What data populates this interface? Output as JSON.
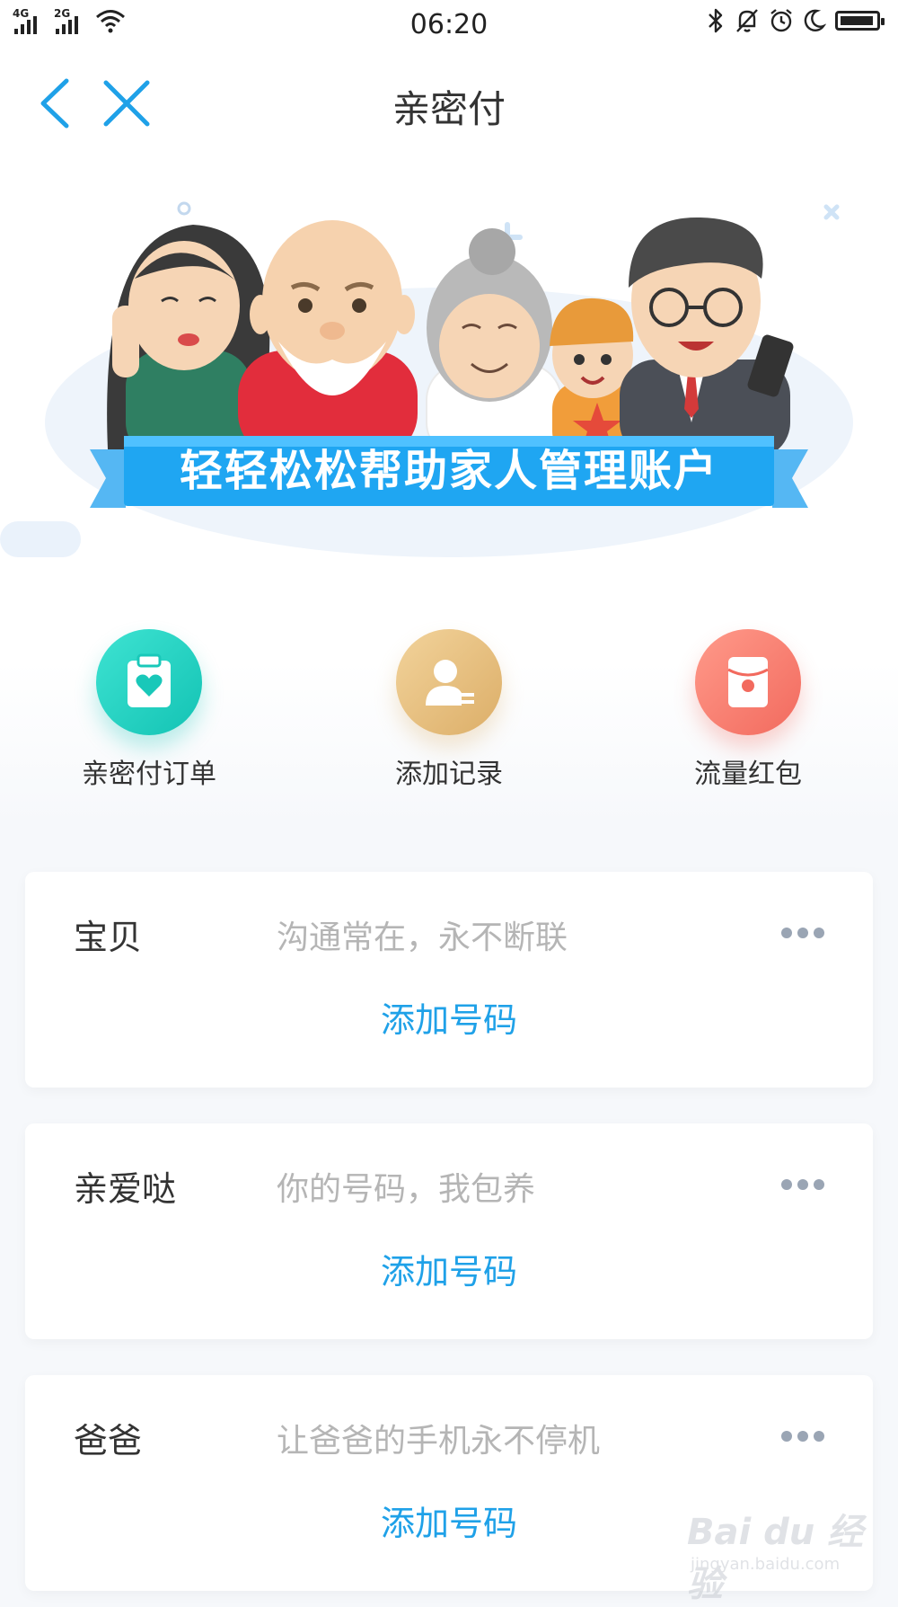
{
  "status_bar": {
    "network1": "4G",
    "network2": "2G",
    "time": "06:20",
    "battery_level": 0.95
  },
  "nav": {
    "title": "亲密付",
    "back_icon": "chevron-left-icon",
    "close_icon": "close-icon"
  },
  "banner": {
    "text": "轻轻松松帮助家人管理账户"
  },
  "actions": [
    {
      "label": "亲密付订单",
      "icon": "order-heart-icon",
      "color": "#19c8b9"
    },
    {
      "label": "添加记录",
      "icon": "user-record-icon",
      "color": "#dcae68"
    },
    {
      "label": "流量红包",
      "icon": "red-envelope-icon",
      "color": "#f26a5e"
    }
  ],
  "cards": [
    {
      "name": "宝贝",
      "slogan": "沟通常在，永不断联",
      "action": "添加号码"
    },
    {
      "name": "亲爱哒",
      "slogan": "你的号码，我包养",
      "action": "添加号码"
    },
    {
      "name": "爸爸",
      "slogan": "让爸爸的手机永不停机",
      "action": "添加号码"
    }
  ],
  "watermark": {
    "main": "Bai du 经验",
    "sub": "jingyan.baidu.com"
  },
  "colors": {
    "accent": "#1fa1e8",
    "slogan": "#b5b5b5"
  }
}
